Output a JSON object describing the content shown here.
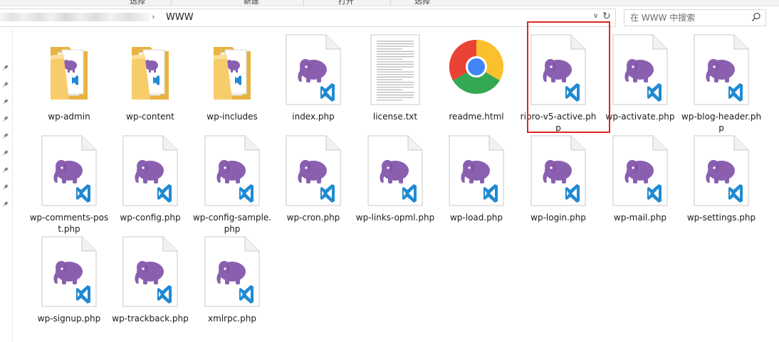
{
  "ribbon": {
    "tabs": [
      "选择",
      "新建",
      "打开",
      "选择"
    ]
  },
  "address_bar": {
    "current_folder": "WWW"
  },
  "search": {
    "placeholder": "在 WWW 中搜索"
  },
  "colors": {
    "selection_outline": "#e02424",
    "php_elephant": "#8a5fb0",
    "vscode_badge": "#1f8ad2",
    "folder": "#f7cd6b"
  },
  "files": [
    {
      "name": "wp-admin",
      "type": "folder"
    },
    {
      "name": "wp-content",
      "type": "folder"
    },
    {
      "name": "wp-includes",
      "type": "folder"
    },
    {
      "name": "index.php",
      "type": "php"
    },
    {
      "name": "license.txt",
      "type": "txt"
    },
    {
      "name": "readme.html",
      "type": "html"
    },
    {
      "name": "ripro-v5-active.php",
      "type": "php",
      "highlighted": true
    },
    {
      "name": "wp-activate.php",
      "type": "php"
    },
    {
      "name": "wp-blog-header.php",
      "type": "php"
    },
    {
      "name": "wp-comments-post.php",
      "type": "php"
    },
    {
      "name": "wp-config.php",
      "type": "php"
    },
    {
      "name": "wp-config-sample.php",
      "type": "php"
    },
    {
      "name": "wp-cron.php",
      "type": "php"
    },
    {
      "name": "wp-links-opml.php",
      "type": "php"
    },
    {
      "name": "wp-load.php",
      "type": "php"
    },
    {
      "name": "wp-login.php",
      "type": "php"
    },
    {
      "name": "wp-mail.php",
      "type": "php"
    },
    {
      "name": "wp-settings.php",
      "type": "php"
    },
    {
      "name": "wp-signup.php",
      "type": "php"
    },
    {
      "name": "wp-trackback.php",
      "type": "php"
    },
    {
      "name": "xmlrpc.php",
      "type": "php"
    }
  ]
}
